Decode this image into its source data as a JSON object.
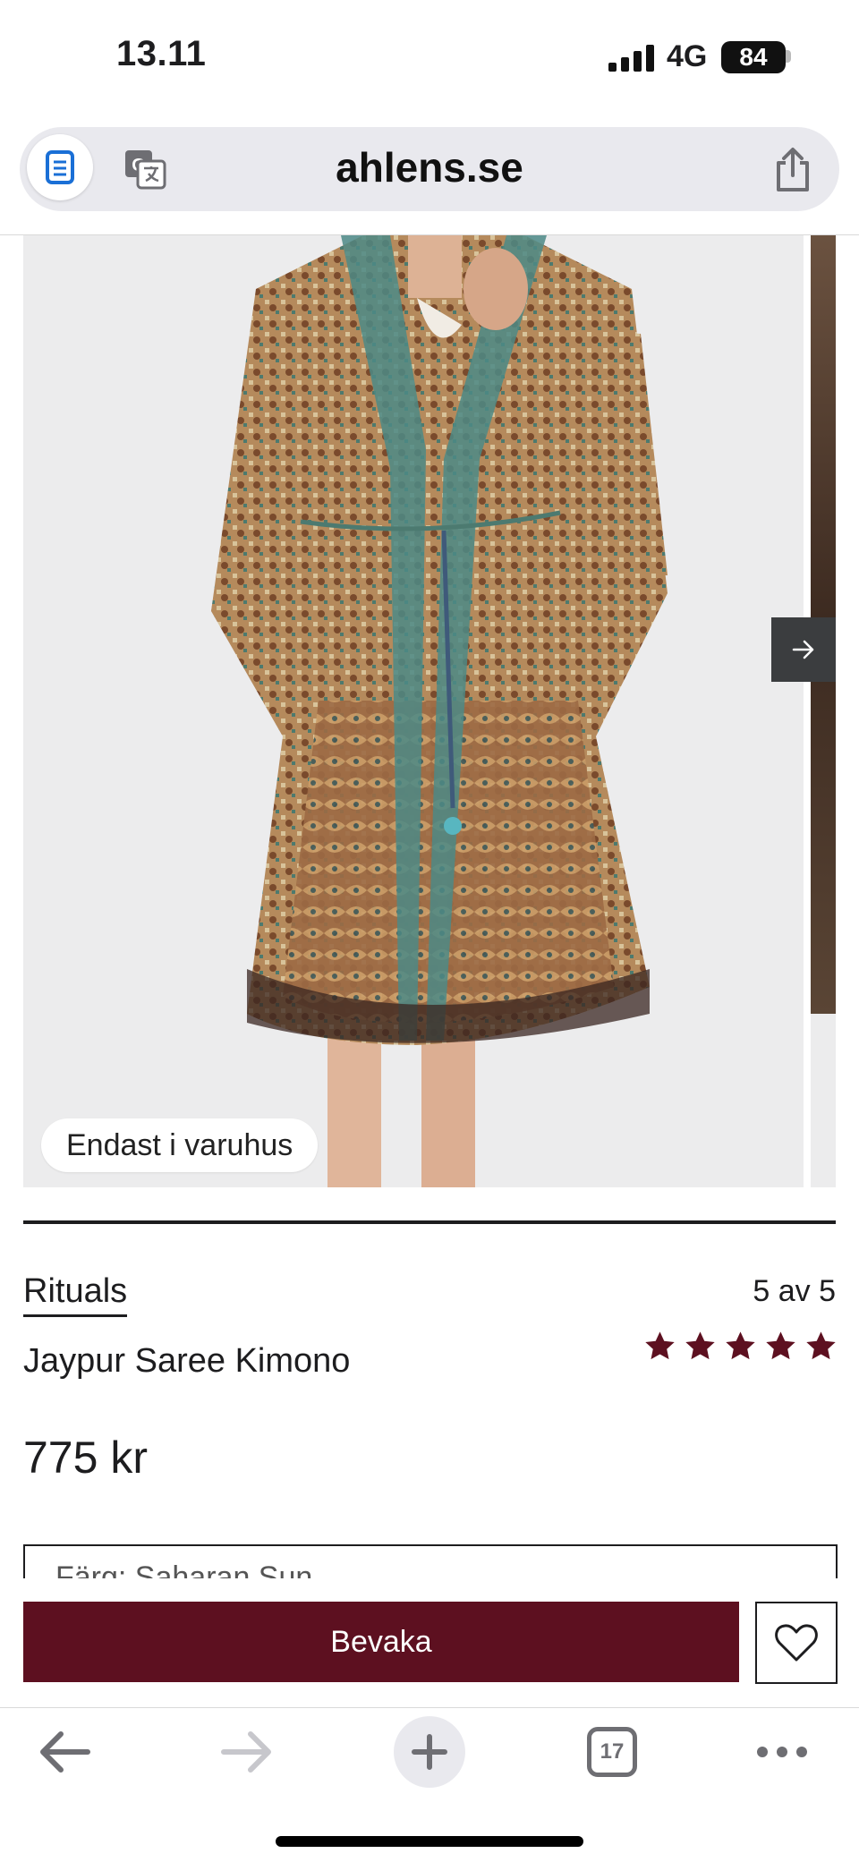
{
  "status_bar": {
    "time": "13.11",
    "network": "4G",
    "battery": "84"
  },
  "browser": {
    "url": "ahlens.se",
    "tab_count": "17",
    "icons": [
      "reader-icon",
      "translate-icon",
      "share-icon",
      "back-arrow-icon",
      "forward-arrow-icon",
      "plus-icon",
      "tabs-icon",
      "more-icon"
    ]
  },
  "product": {
    "image_badge": "Endast i varuhus",
    "brand": "Rituals",
    "name": "Jaypur Saree Kimono",
    "rating_text": "5 av 5",
    "rating_value": 5,
    "price": "775 kr",
    "option_text": "Färg: Saharan Sun",
    "watch_label": "Bevaka"
  },
  "colors": {
    "accent": "#5d1020",
    "star": "#5d1020"
  }
}
